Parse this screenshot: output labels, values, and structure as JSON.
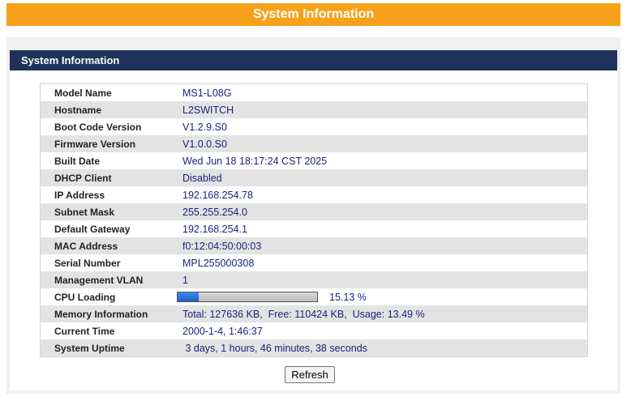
{
  "page_title": "System Information",
  "panel_title": "System Information",
  "rows": [
    {
      "label": "Model Name",
      "value": "MS1-L08G"
    },
    {
      "label": "Hostname",
      "value": "L2SWITCH"
    },
    {
      "label": "Boot Code Version",
      "value": "V1.2.9.S0"
    },
    {
      "label": "Firmware Version",
      "value": "V1.0.0.S0"
    },
    {
      "label": "Built Date",
      "value": "Wed Jun 18 18:17:24 CST 2025"
    },
    {
      "label": "DHCP Client",
      "value": "Disabled"
    },
    {
      "label": "IP Address",
      "value": "192.168.254.78"
    },
    {
      "label": "Subnet Mask",
      "value": "255.255.254.0"
    },
    {
      "label": "Default Gateway",
      "value": "192.168.254.1"
    },
    {
      "label": "MAC Address",
      "value": "f0:12:04:50:00:03"
    },
    {
      "label": "Serial Number",
      "value": "MPL255000308"
    },
    {
      "label": "Management VLAN",
      "value": "1"
    }
  ],
  "cpu": {
    "label": "CPU Loading",
    "percent": 15.13,
    "text": "15.13 %"
  },
  "memory": {
    "label": "Memory Information",
    "value": "Total: 127636 KB,  Free: 110424 KB,  Usage: 13.49 %"
  },
  "current_time": {
    "label": "Current Time",
    "value": "2000-1-4, 1:46:37"
  },
  "uptime": {
    "label": "System Uptime",
    "value": " 3 days, 1 hours, 46 minutes, 38 seconds"
  },
  "refresh_label": "Refresh",
  "colors": {
    "banner": "#f7a11a",
    "header": "#1d3359",
    "value_text": "#1a237e",
    "cpu_fill": "#1a5fc4"
  }
}
